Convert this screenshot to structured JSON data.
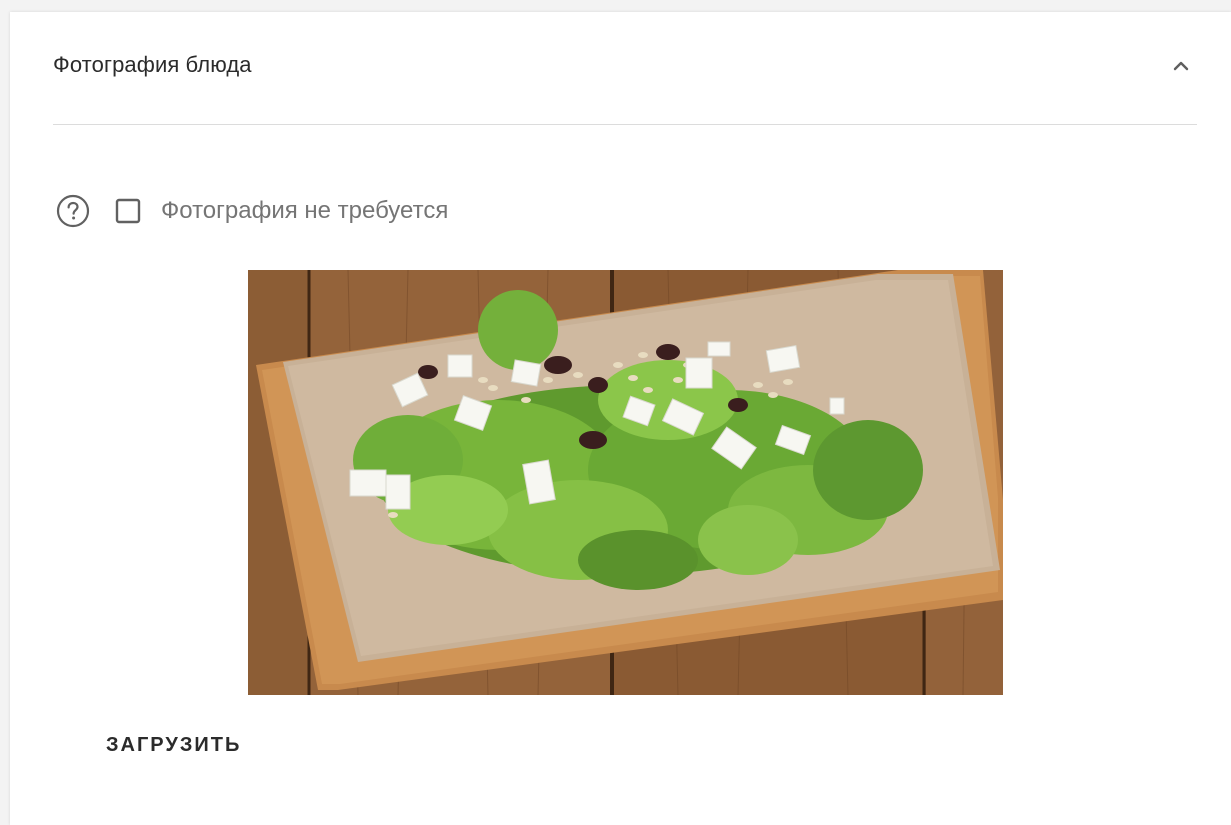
{
  "panel": {
    "title": "Фотография блюда",
    "collapse_icon": "chevron-up-icon"
  },
  "photo_options": {
    "help_icon": "help-circle-icon",
    "no_photo_checked": false,
    "no_photo_label": "Фотография не требуется"
  },
  "photo": {
    "description": "dish photo preview"
  },
  "actions": {
    "upload_label": "ЗАГРУЗИТЬ"
  },
  "colors": {
    "text_primary": "#2b2b2b",
    "text_secondary": "#757575",
    "divider": "#dcdcdc"
  }
}
